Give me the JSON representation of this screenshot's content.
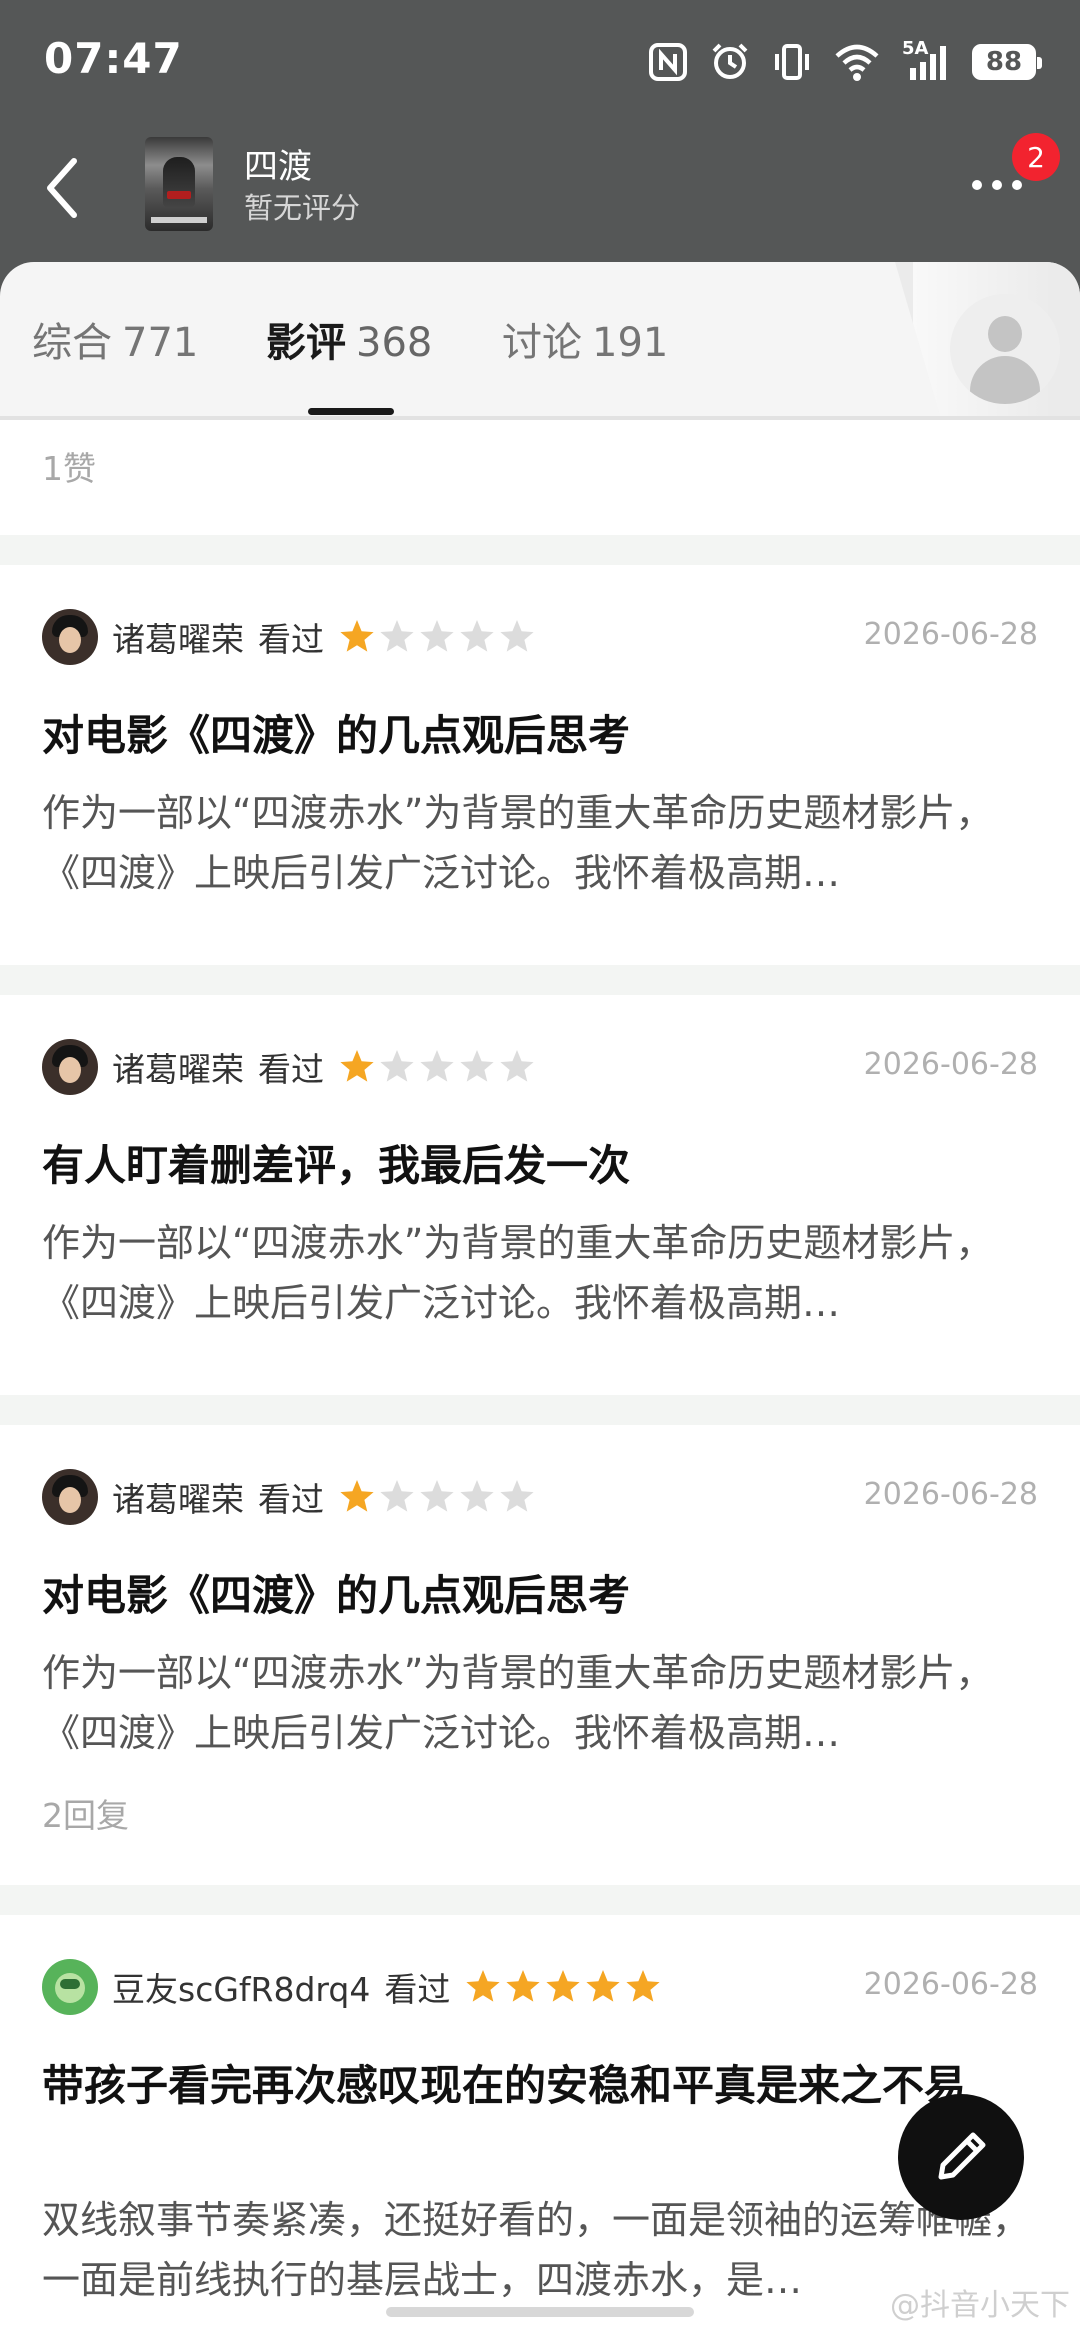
{
  "status_bar": {
    "time": "07:47",
    "network": "5A",
    "battery": "88"
  },
  "nav": {
    "movie_title": "四渡",
    "movie_rating": "暂无评分",
    "notification_count": "2"
  },
  "tabs": [
    {
      "label": "综合",
      "count": "771",
      "active": false
    },
    {
      "label": "影评",
      "count": "368",
      "active": true
    },
    {
      "label": "讨论",
      "count": "191",
      "active": false
    }
  ],
  "likes_strip": {
    "text": "1赞"
  },
  "reviews": [
    {
      "user": "诸葛曜荣",
      "status": "看过",
      "stars": 1,
      "date": "2026-06-28",
      "title": "对电影《四渡》的几点观后思考",
      "body": "作为一部以“四渡赤水”为背景的重大革命历史题材影片，《四渡》上映后引发广泛讨论。我怀着极高期…"
    },
    {
      "user": "诸葛曜荣",
      "status": "看过",
      "stars": 1,
      "date": "2026-06-28",
      "title": "有人盯着删差评，我最后发一次",
      "body": "作为一部以“四渡赤水”为背景的重大革命历史题材影片，《四渡》上映后引发广泛讨论。我怀着极高期…"
    },
    {
      "user": "诸葛曜荣",
      "status": "看过",
      "stars": 1,
      "date": "2026-06-28",
      "title": "对电影《四渡》的几点观后思考",
      "body": "作为一部以“四渡赤水”为背景的重大革命历史题材影片，《四渡》上映后引发广泛讨论。我怀着极高期…",
      "replies": "2回复"
    },
    {
      "user": "豆友scGfR8drq4",
      "status": "看过",
      "stars": 5,
      "date": "2026-06-28",
      "title": "带孩子看完再次感叹现在的安稳和平真是来之不易",
      "body": "双线叙事节奏紧凑，还挺好看的，一面是领袖的运筹帷幄，一面是前线执行的基层战士，四渡赤水，是…"
    }
  ],
  "watermark": "@抖音小天下",
  "colors": {
    "header_bg": "#555757",
    "star_filled": "#f5a623",
    "star_empty": "#dcdcdc",
    "badge": "#f2232f"
  }
}
